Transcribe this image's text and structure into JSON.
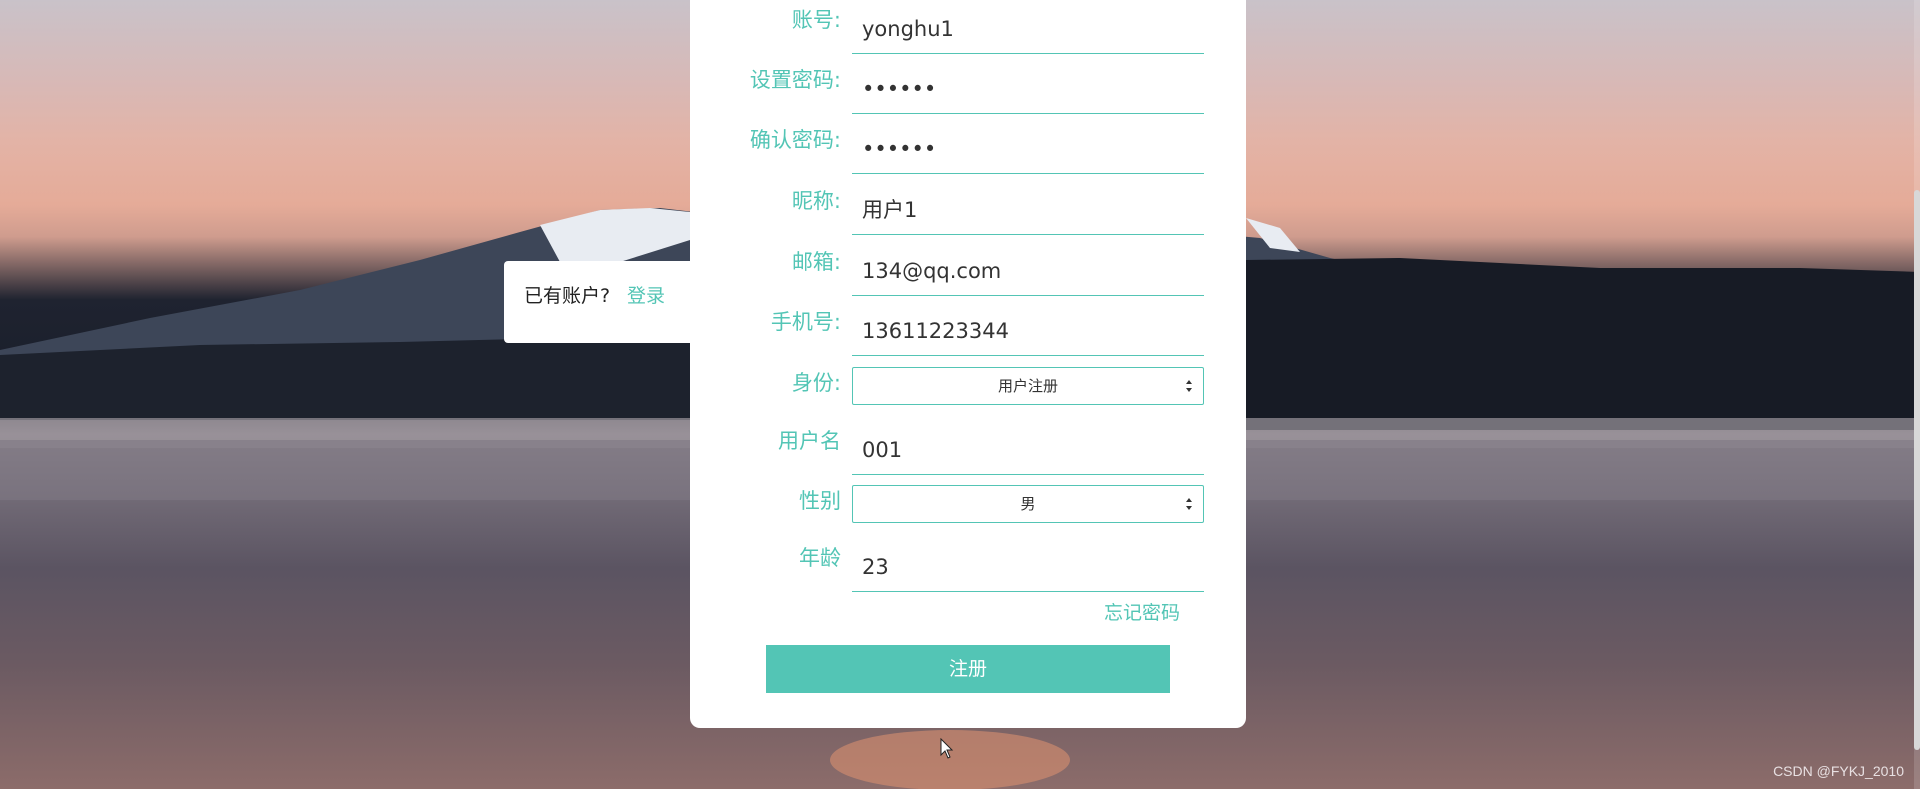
{
  "login_prompt": {
    "question": "已有账户?",
    "link": "登录"
  },
  "form": {
    "fields": [
      {
        "label": "账号:",
        "value": "yonghu1",
        "type": "text"
      },
      {
        "label": "设置密码:",
        "value": "••••••",
        "type": "password"
      },
      {
        "label": "确认密码:",
        "value": "••••••",
        "type": "password"
      },
      {
        "label": "昵称:",
        "value": "用户1",
        "type": "text"
      },
      {
        "label": "邮箱:",
        "value": "134@qq.com",
        "type": "text"
      },
      {
        "label": "手机号:",
        "value": "13611223344",
        "type": "text"
      },
      {
        "label": "身份:",
        "value": "用户注册",
        "type": "select"
      },
      {
        "label": "用户名",
        "value": "001",
        "type": "text"
      },
      {
        "label": "性别",
        "value": "男",
        "type": "select"
      },
      {
        "label": "年龄",
        "value": "23",
        "type": "text"
      }
    ],
    "forgot_link": "忘记密码",
    "submit_label": "注册"
  },
  "watermark": "CSDN @FYKJ_2010",
  "colors": {
    "accent": "#53c5b5",
    "card": "#ffffff"
  }
}
